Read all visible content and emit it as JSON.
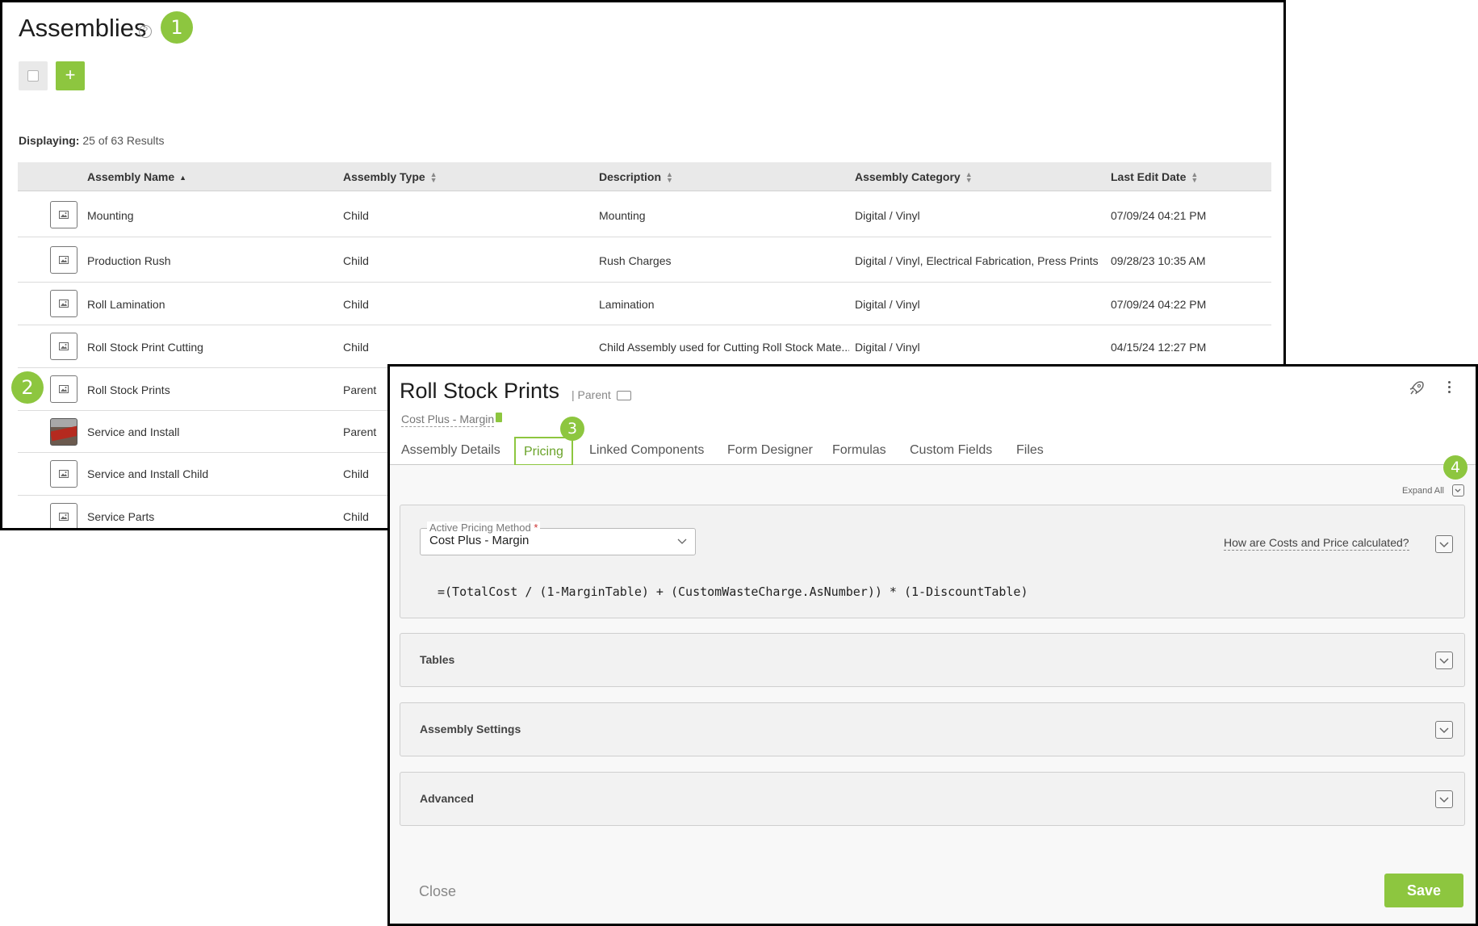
{
  "list": {
    "title": "Assemblies",
    "help_icon": "?",
    "add_icon": "+",
    "displaying_label": "Displaying:",
    "displaying_value": "25 of 63 Results",
    "columns": {
      "name": "Assembly Name",
      "type": "Assembly Type",
      "description": "Description",
      "category": "Assembly Category",
      "last_edit": "Last Edit Date"
    },
    "rows": [
      {
        "name": "Mounting",
        "type": "Child",
        "description": "Mounting",
        "category": "Digital / Vinyl",
        "date": "07/09/24 04:21 PM"
      },
      {
        "name": "Production Rush",
        "type": "Child",
        "description": "Rush Charges",
        "category": "Digital / Vinyl, Electrical Fabrication, Press Prints",
        "date": "09/28/23 10:35 AM"
      },
      {
        "name": "Roll Lamination",
        "type": "Child",
        "description": "Lamination",
        "category": "Digital / Vinyl",
        "date": "07/09/24 04:22 PM"
      },
      {
        "name": "Roll Stock Print Cutting",
        "type": "Child",
        "description": "Child Assembly used for Cutting Roll Stock Mate...",
        "category": "Digital / Vinyl",
        "date": "04/15/24 12:27 PM"
      },
      {
        "name": "Roll Stock Prints",
        "type": "Parent"
      },
      {
        "name": "Service and Install",
        "type": "Parent"
      },
      {
        "name": "Service and Install Child",
        "type": "Child"
      },
      {
        "name": "Service Parts",
        "type": "Child"
      }
    ]
  },
  "callouts": [
    "1",
    "2",
    "3",
    "4"
  ],
  "detail": {
    "title": "Roll Stock Prints",
    "type_label": "| Parent",
    "pricing_method_link": "Cost Plus - Margin",
    "tabs": [
      "Assembly Details",
      "Pricing",
      "Linked Components",
      "Form Designer",
      "Formulas",
      "Custom Fields",
      "Files"
    ],
    "active_tab": "Pricing",
    "expand_all": "Expand All",
    "pricing_panel": {
      "field_label": "Active Pricing Method",
      "required_mark": "*",
      "field_value": "Cost Plus - Margin",
      "help_link": "How are Costs and Price calculated?",
      "formula": "=(TotalCost / (1-MarginTable) + (CustomWasteCharge.AsNumber)) * (1-DiscountTable)"
    },
    "panels": [
      "Tables",
      "Assembly Settings",
      "Advanced"
    ],
    "close_label": "Close",
    "save_label": "Save"
  },
  "colors": {
    "accent": "#8dc63f",
    "border": "#000000",
    "header_bg": "#e9e9e9"
  },
  "icons": [
    "help-icon",
    "checkbox-icon",
    "plus-icon",
    "sort-icon",
    "image-placeholder-icon",
    "tag-icon",
    "calculator-icon",
    "rocket-icon",
    "kebab-icon",
    "chevron-down-icon"
  ]
}
